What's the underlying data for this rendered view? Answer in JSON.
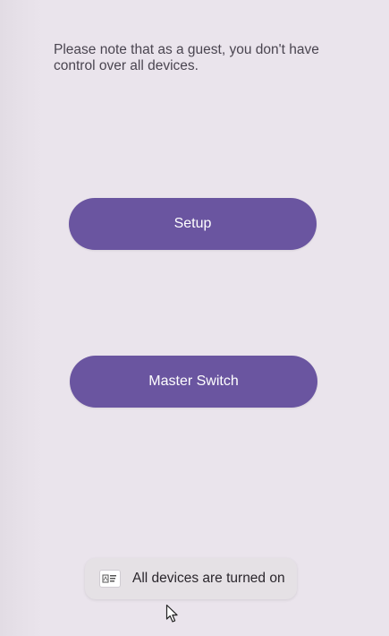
{
  "info": {
    "guest_note": "Please note that as a guest, you don't have control over all devices."
  },
  "buttons": {
    "setup_label": "Setup",
    "master_switch_label": "Master Switch"
  },
  "toast": {
    "message": "All devices are turned on",
    "icon": "app-icon"
  },
  "colors": {
    "background": "#EAE4EC",
    "primary_button": "#6A55A0",
    "toast_background": "#E5E1E5"
  }
}
